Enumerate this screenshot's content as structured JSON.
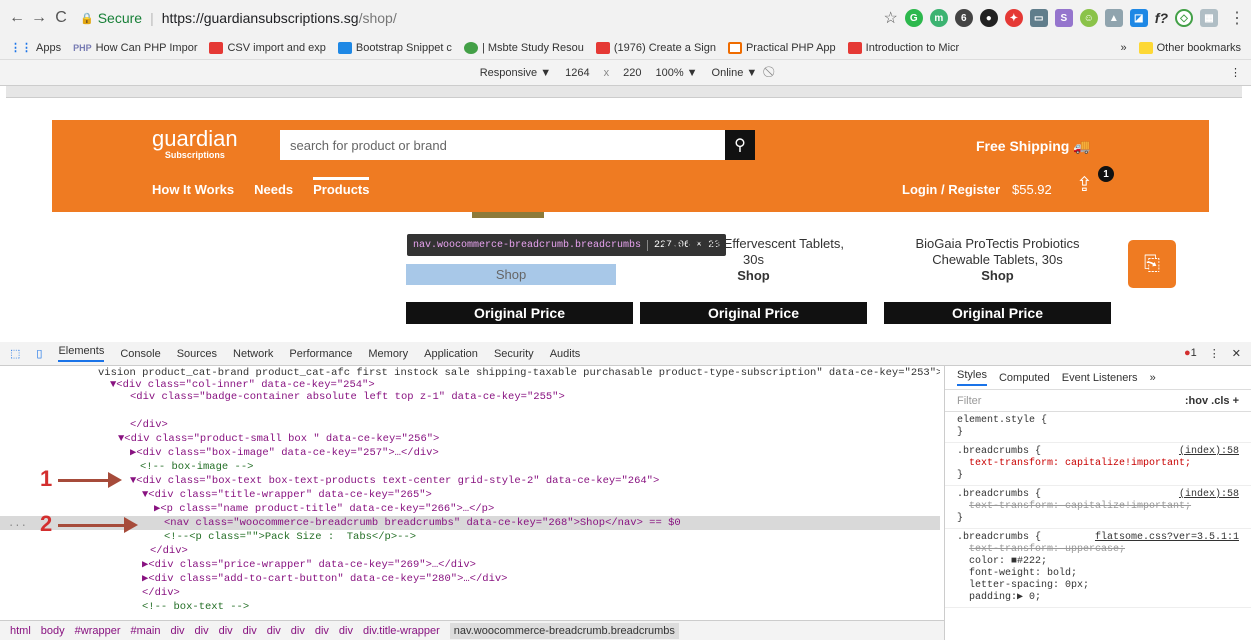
{
  "browser": {
    "secure_label": "Secure",
    "url_host": "https://guardiansubscriptions.sg",
    "url_path": "/shop/"
  },
  "bookmarks": {
    "items": [
      "Apps",
      "How Can PHP Impor",
      "CSV import and exp",
      "Bootstrap Snippet c",
      "| Msbte Study Resou",
      "(1976) Create a Sign",
      "Practical PHP App",
      "Introduction to Micr"
    ],
    "more": "»",
    "other": "Other bookmarks"
  },
  "devicebar": {
    "mode": "Responsive ▼",
    "width": "1264",
    "times": "x",
    "height": "220",
    "zoom": "100% ▼",
    "network": "Online ▼"
  },
  "site": {
    "logo": "guardian",
    "logo_sub": "Subscriptions",
    "search_placeholder": "search for product or brand",
    "free_shipping": "Free Shipping",
    "nav": [
      "How It Works",
      "Needs",
      "Products"
    ],
    "login": "Login / Register",
    "cart_total": "$55.92",
    "cart_count": "1",
    "tooltip_name": "nav.woocommerce-breadcrumb.breadcrumbs",
    "tooltip_size": "227.06 × 23",
    "products": [
      {
        "title": "",
        "shop": "Shop",
        "price": "Original Price"
      },
      {
        "title": "cca Boost Effervescent Tablets, 30s",
        "shop": "Shop",
        "price": "Original Price"
      },
      {
        "title": "BioGaia ProTectis Probiotics Chewable Tablets, 30s",
        "shop": "Shop",
        "price": "Original Price"
      }
    ]
  },
  "devtools": {
    "tabs": [
      "Elements",
      "Console",
      "Sources",
      "Network",
      "Performance",
      "Memory",
      "Application",
      "Security",
      "Audits"
    ],
    "error_count": "1",
    "lines": [
      "vision product_cat-brand product_cat-afc first instock sale shipping-taxable purchasable product-type-subscription\" data-ce-key=\"253\">",
      "▼<div class=\"col-inner\" data-ce-key=\"254\">",
      "<div class=\"badge-container absolute left top z-1\" data-ce-key=\"255\">",
      "",
      "</div>",
      "▼<div class=\"product-small box \" data-ce-key=\"256\">",
      "▶<div class=\"box-image\" data-ce-key=\"257\">…</div>",
      "<!-- box-image -->",
      "▼<div class=\"box-text box-text-products text-center grid-style-2\" data-ce-key=\"264\">",
      "▼<div class=\"title-wrapper\" data-ce-key=\"265\">",
      "▶<p class=\"name product-title\" data-ce-key=\"266\">…</p>",
      "<nav class=\"woocommerce-breadcrumb breadcrumbs\" data-ce-key=\"268\">Shop</nav> == $0",
      "<!--<p class=\"\">Pack Size :  Tabs</p>-->",
      "</div>",
      "▶<div class=\"price-wrapper\" data-ce-key=\"269\">…</div>",
      "▶<div class=\"add-to-cart-button\" data-ce-key=\"280\">…</div>",
      "</div>",
      "<!-- box-text -->"
    ],
    "annotations": [
      "1",
      "2"
    ],
    "styles_tabs": [
      "Styles",
      "Computed",
      "Event Listeners",
      "»"
    ],
    "filter_placeholder": "Filter",
    "filter_tools": ":hov .cls +",
    "rules": [
      {
        "selector": "element.style {",
        "source": "",
        "body": [
          "}"
        ]
      },
      {
        "selector": ".breadcrumbs {",
        "source": "(index):58",
        "body": [
          "text-transform: capitalize!important;",
          "}"
        ]
      },
      {
        "selector": ".breadcrumbs {",
        "source": "(index):58",
        "body": [
          "text-transform: capitalize!important;",
          "}"
        ]
      },
      {
        "selector": ".breadcrumbs {",
        "source": "flatsome.css?ver=3.5.1:1",
        "body": [
          "text-transform: uppercase;",
          "color: ■#222;",
          "font-weight: bold;",
          "letter-spacing: 0px;",
          "padding:▶ 0;"
        ]
      }
    ],
    "breadcrumbs": [
      "html",
      "body",
      "#wrapper",
      "#main",
      "div",
      "div",
      "div",
      "div",
      "div",
      "div",
      "div",
      "div",
      "div.title-wrapper",
      "nav.woocommerce-breadcrumb.breadcrumbs"
    ]
  }
}
